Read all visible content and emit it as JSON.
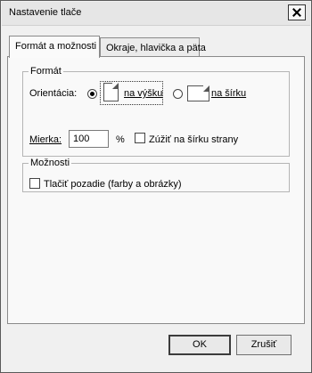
{
  "window": {
    "title": "Nastavenie tlače"
  },
  "tabs": [
    {
      "label": "Formát a možnosti",
      "active": true
    },
    {
      "label": "Okraje, hlavička a päta",
      "active": false
    }
  ],
  "format_group": {
    "title": "Formát",
    "orientation_label": "Orientácia:",
    "portrait_label": "na výšku",
    "portrait_checked": true,
    "landscape_label": "na šírku",
    "landscape_checked": false,
    "scale_label": "Mierka:",
    "scale_value": "100",
    "percent_label": "%",
    "shrink_label": "Zúžiť na šírku strany",
    "shrink_checked": false
  },
  "options_group": {
    "title": "Možnosti",
    "print_background_label": "Tlačiť pozadie (farby a obrázky)",
    "print_background_checked": false
  },
  "buttons": {
    "ok": "OK",
    "cancel": "Zrušiť"
  },
  "colors": {
    "window_bg": "#f0f0f0",
    "panel_bg": "#f9f9f9",
    "border": "#8a8a8a"
  }
}
